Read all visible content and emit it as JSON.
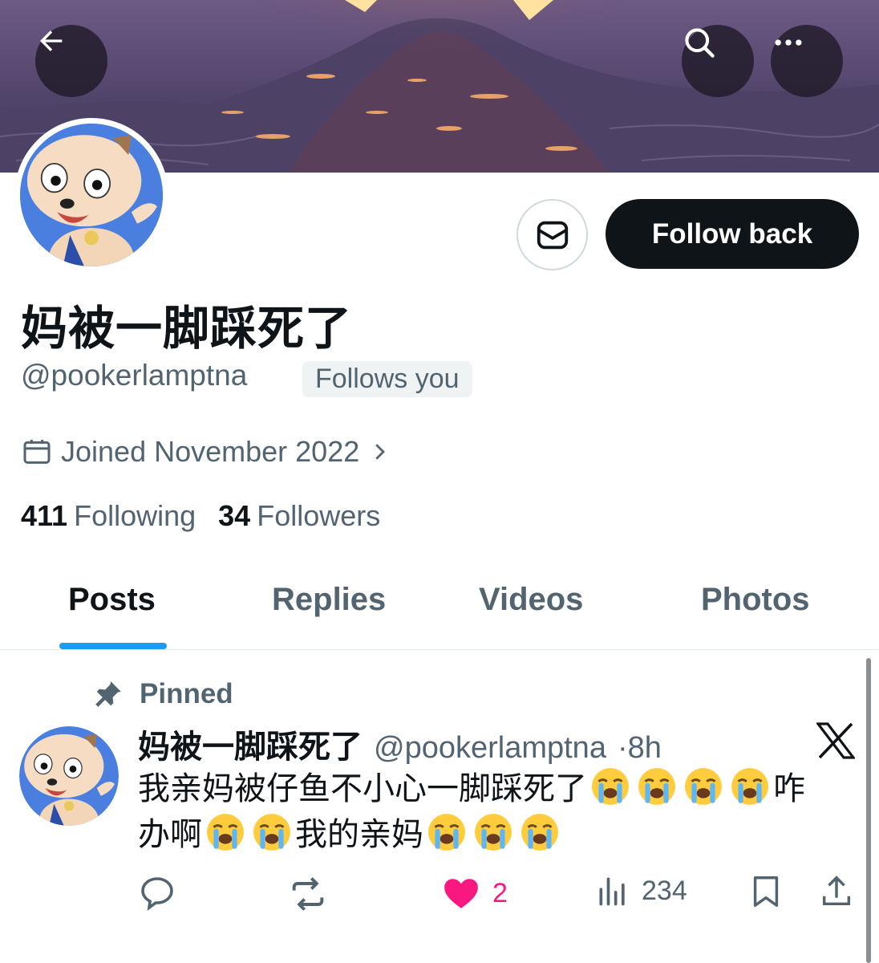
{
  "header": {
    "back_icon": "arrow-left-icon",
    "search_icon": "search-icon",
    "more_icon": "more-horizontal-icon"
  },
  "profile": {
    "display_name": "妈被一脚踩死了",
    "handle": "@pookerlamptna",
    "follows_you_badge": "Follows you",
    "joined": "Joined November 2022",
    "following_count": "411",
    "following_label": "Following",
    "followers_count": "34",
    "followers_label": "Followers",
    "follow_back_label": "Follow back",
    "message_icon": "mail-icon"
  },
  "tabs": [
    {
      "label": "Posts",
      "active": true
    },
    {
      "label": "Replies",
      "active": false
    },
    {
      "label": "Videos",
      "active": false
    },
    {
      "label": "Photos",
      "active": false
    }
  ],
  "post": {
    "pinned_label": "Pinned",
    "author_name": "妈被一脚踩死了",
    "author_handle": "@pookerlamptna",
    "time": "·8h",
    "text_line1": "我亲妈被仔鱼不小心一脚踩死了",
    "text_line1_suffix": "咋",
    "text_line2_prefix": "办啊",
    "text_line2_mid": "我的亲妈",
    "emoji_name": "loudly-crying-face",
    "likes": "2",
    "views": "234"
  },
  "colors": {
    "accent": "#1d9bf0",
    "like": "#f91880",
    "text_primary": "#0f1419",
    "text_secondary": "#536471"
  }
}
